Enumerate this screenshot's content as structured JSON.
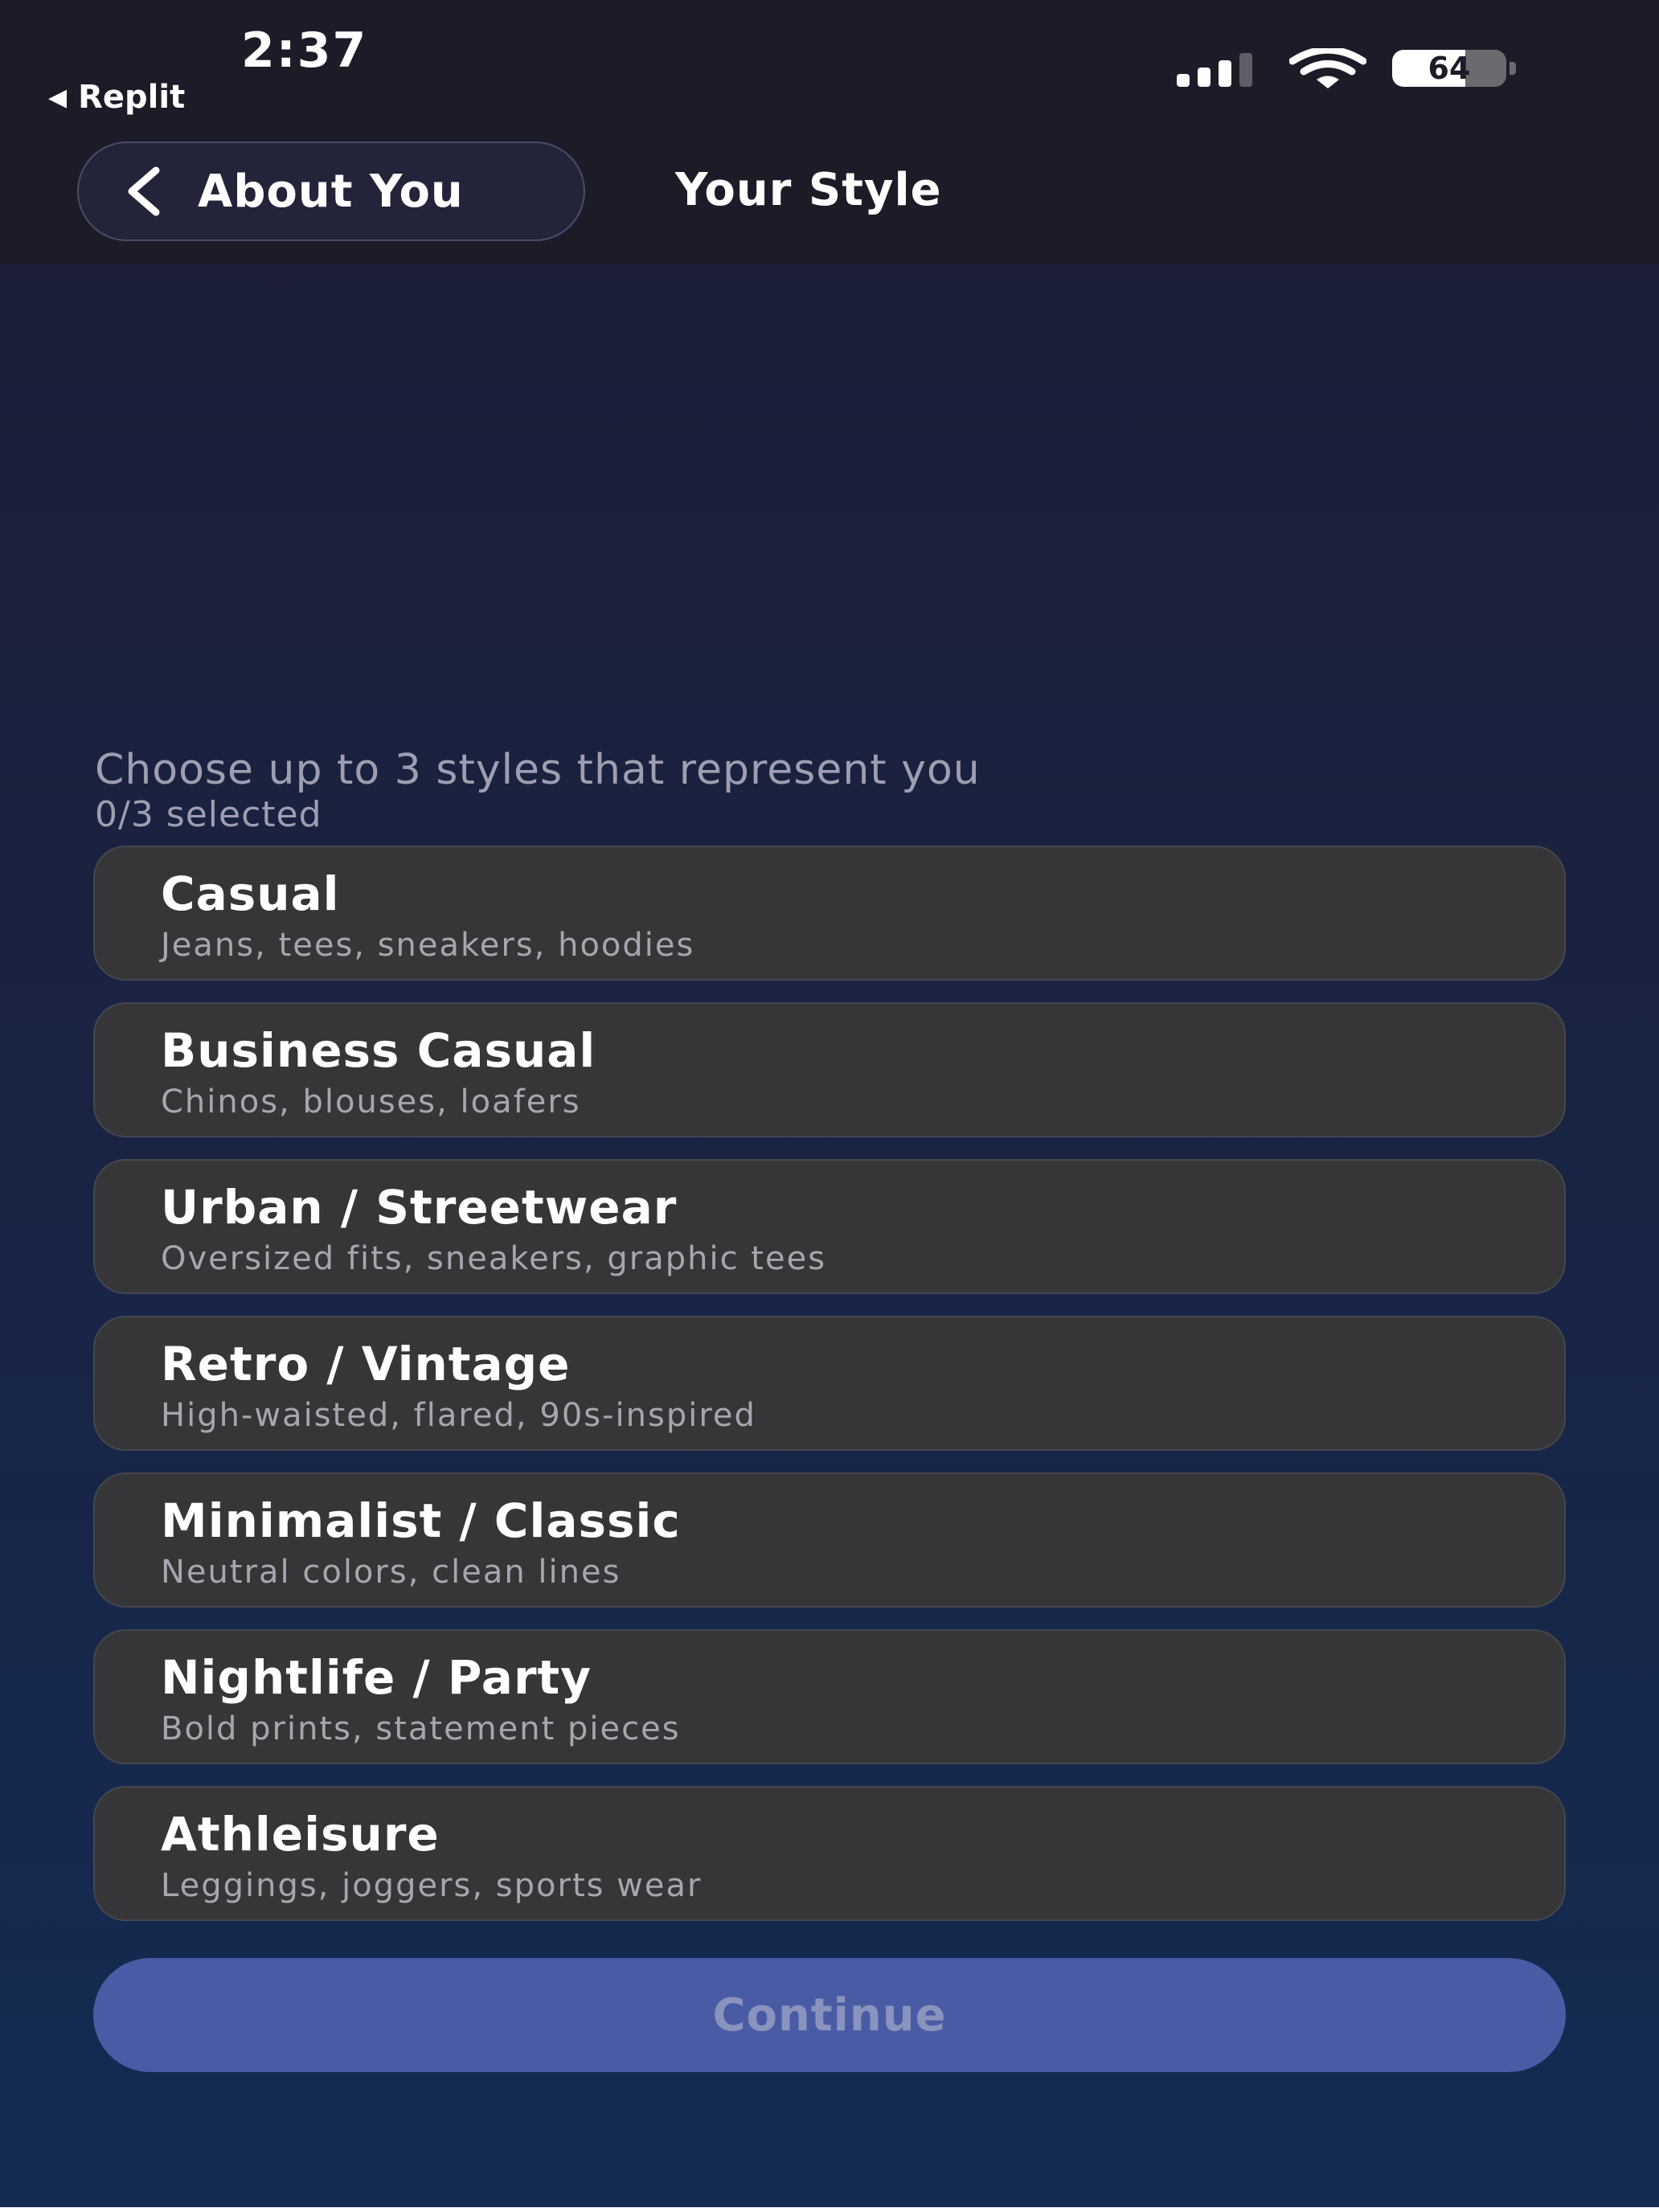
{
  "status_bar": {
    "time": "2:37",
    "back_app": "Replit",
    "battery": "64",
    "battery_level": 0.64
  },
  "nav": {
    "back_label": "About You",
    "title": "Your Style"
  },
  "main": {
    "instruction": "Choose up to 3 styles that represent you",
    "count": "0/3 selected",
    "styles": [
      {
        "name": "Casual",
        "description": "Jeans, tees, sneakers, hoodies"
      },
      {
        "name": "Business Casual",
        "description": "Chinos, blouses, loafers"
      },
      {
        "name": "Urban / Streetwear",
        "description": "Oversized fits, sneakers, graphic tees"
      },
      {
        "name": "Retro / Vintage",
        "description": "High-waisted, flared, 90s-inspired"
      },
      {
        "name": "Minimalist / Classic",
        "description": "Neutral colors, clean lines"
      },
      {
        "name": "Nightlife / Party",
        "description": "Bold prints, statement pieces"
      },
      {
        "name": "Athleisure",
        "description": "Leggings, joggers, sports wear"
      }
    ],
    "continue_label": "Continue"
  },
  "colors": {
    "accent": "#4a5ba6",
    "card": "#363639",
    "muted_text": "#9d9fb0"
  }
}
